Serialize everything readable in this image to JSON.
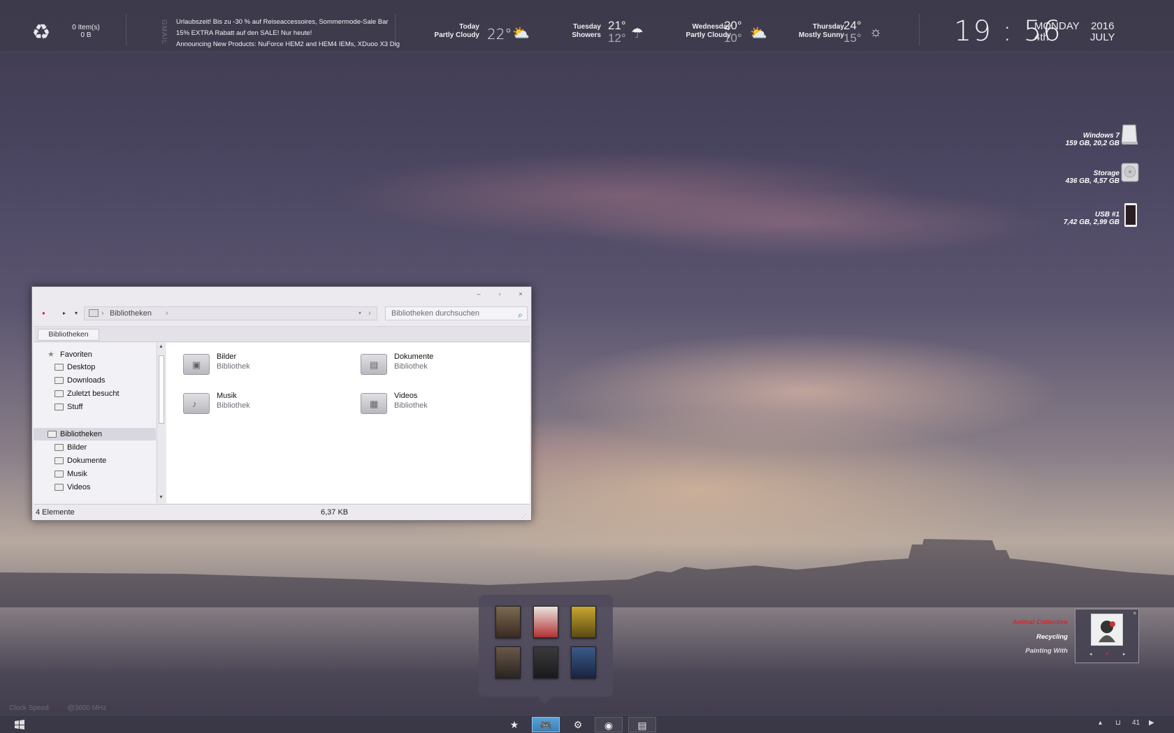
{
  "colors": {
    "accent": "#3a7fb8",
    "music_artist": "#e0222b"
  },
  "topbar": {
    "recycle": {
      "items": "0 Item(s)",
      "size": "0 B",
      "icon": "recycle-icon"
    },
    "gmail_label": "GMAIL",
    "mail_lines": [
      "Urlaubszeit! Bis zu -30 % auf Reiseaccessoires, Sommermode-Sale Bar",
      "15% EXTRA Rabatt auf den SALE! Nur heute!",
      "Announcing New Products: NuForce HEM2 and HEM4 IEMs, XDuoo X3 Dig"
    ],
    "weather": [
      {
        "day": "Today",
        "cond": "Partly Cloudy",
        "temp": "22°",
        "icon": "partly-cloudy-icon"
      },
      {
        "day": "Tuesday",
        "cond": "Showers",
        "high": "21°",
        "low": "12°",
        "icon": "showers-icon"
      },
      {
        "day": "Wednesday",
        "cond": "Partly Cloudy",
        "high": "20°",
        "low": "10°",
        "icon": "partly-cloudy-icon"
      },
      {
        "day": "Thursday",
        "cond": "Mostly Sunny",
        "high": "24°",
        "low": "15°",
        "icon": "mostly-sunny-icon"
      }
    ],
    "clock": {
      "time": "19 : 56",
      "weekday": "MONDAY",
      "day": "4th",
      "year": "2016",
      "month": "JULY"
    }
  },
  "drives": [
    {
      "name": "Windows 7",
      "info": "159 GB, 20,2 GB",
      "icon": "hdd-icon"
    },
    {
      "name": "Storage",
      "info": "436 GB, 4,57 GB",
      "icon": "disk-icon"
    },
    {
      "name": "USB #1",
      "info": "7,42 GB, 2,99 GB",
      "icon": "usb-icon"
    }
  ],
  "explorer": {
    "address": "Bibliotheken",
    "search_placeholder": "Bibliotheken durchsuchen",
    "tab": "Bibliotheken",
    "nav": {
      "favorites_label": "Favoriten",
      "favorites": [
        "Desktop",
        "Downloads",
        "Zuletzt besucht",
        "Stuff"
      ],
      "libraries_label": "Bibliotheken",
      "libraries": [
        "Bilder",
        "Dokumente",
        "Musik",
        "Videos"
      ]
    },
    "items": [
      {
        "name": "Bilder",
        "type": "Bibliothek",
        "icon": "pictures-folder-icon"
      },
      {
        "name": "Dokumente",
        "type": "Bibliothek",
        "icon": "documents-folder-icon"
      },
      {
        "name": "Musik",
        "type": "Bibliothek",
        "icon": "music-folder-icon"
      },
      {
        "name": "Videos",
        "type": "Bibliothek",
        "icon": "videos-folder-icon"
      }
    ],
    "status_count": "4 Elemente",
    "status_size": "6,37 KB"
  },
  "music": {
    "artist": "Animal Collective",
    "album": "Recycling",
    "title": "Painting With"
  },
  "cpu": {
    "label": "Clock Speed",
    "value": "@3600 MHz"
  },
  "games": [
    "game-cover-1",
    "game-cover-2",
    "game-cover-3",
    "game-cover-4",
    "game-cover-5",
    "game-cover-6"
  ],
  "taskbar": {
    "buttons": [
      "star-icon",
      "gamepad-icon",
      "gear-icon",
      "firefox-icon",
      "explorer-icon"
    ],
    "tray_volume": "41"
  }
}
